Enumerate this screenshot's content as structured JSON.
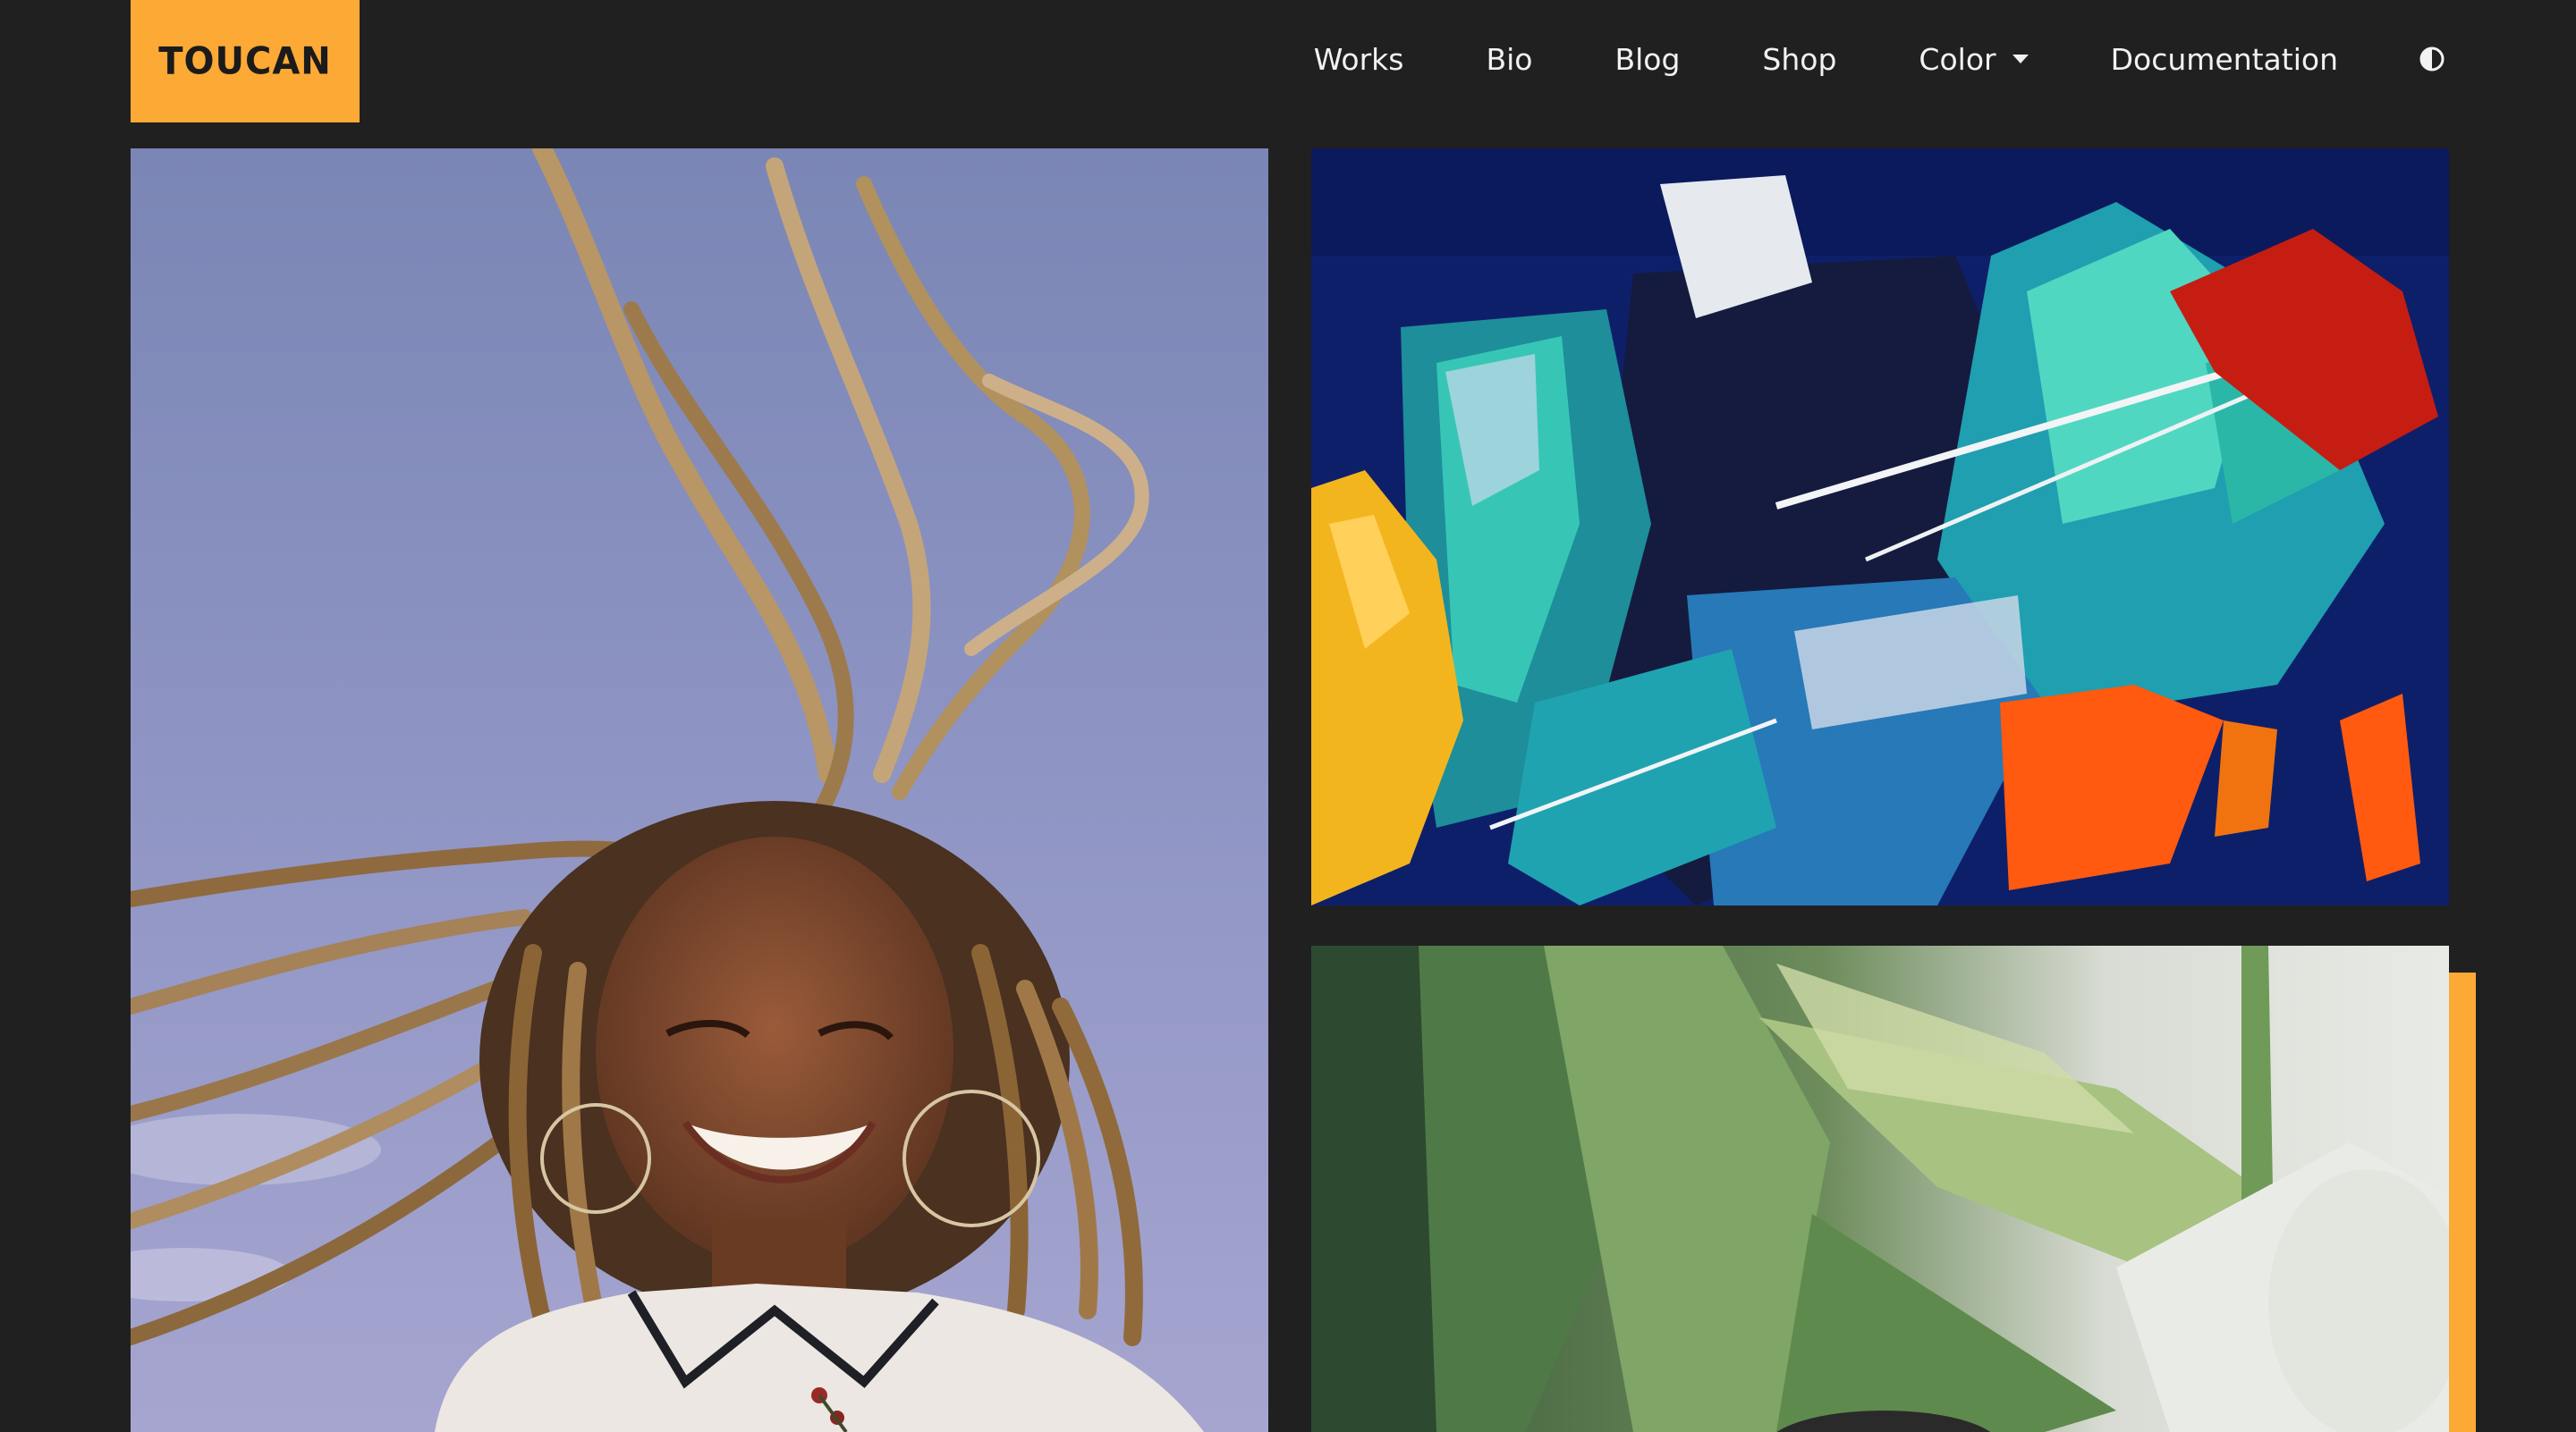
{
  "brand": {
    "name": "TOUCAN",
    "accent_color": "#fca935"
  },
  "nav": {
    "items": [
      {
        "label": "Works"
      },
      {
        "label": "Bio"
      },
      {
        "label": "Blog"
      },
      {
        "label": "Shop"
      },
      {
        "label": "Color",
        "has_dropdown": true
      },
      {
        "label": "Documentation"
      }
    ],
    "theme_toggle_icon": "half-circle-contrast-icon"
  },
  "gallery": {
    "items": [
      {
        "kind": "photo",
        "subject": "smiling woman with long braids against sky"
      },
      {
        "kind": "painting",
        "subject": "abstract acrylic paint strokes"
      },
      {
        "kind": "painting",
        "subject": "green leaves close-up"
      }
    ]
  },
  "colors": {
    "background": "#202020",
    "text": "#f2f2f2"
  }
}
